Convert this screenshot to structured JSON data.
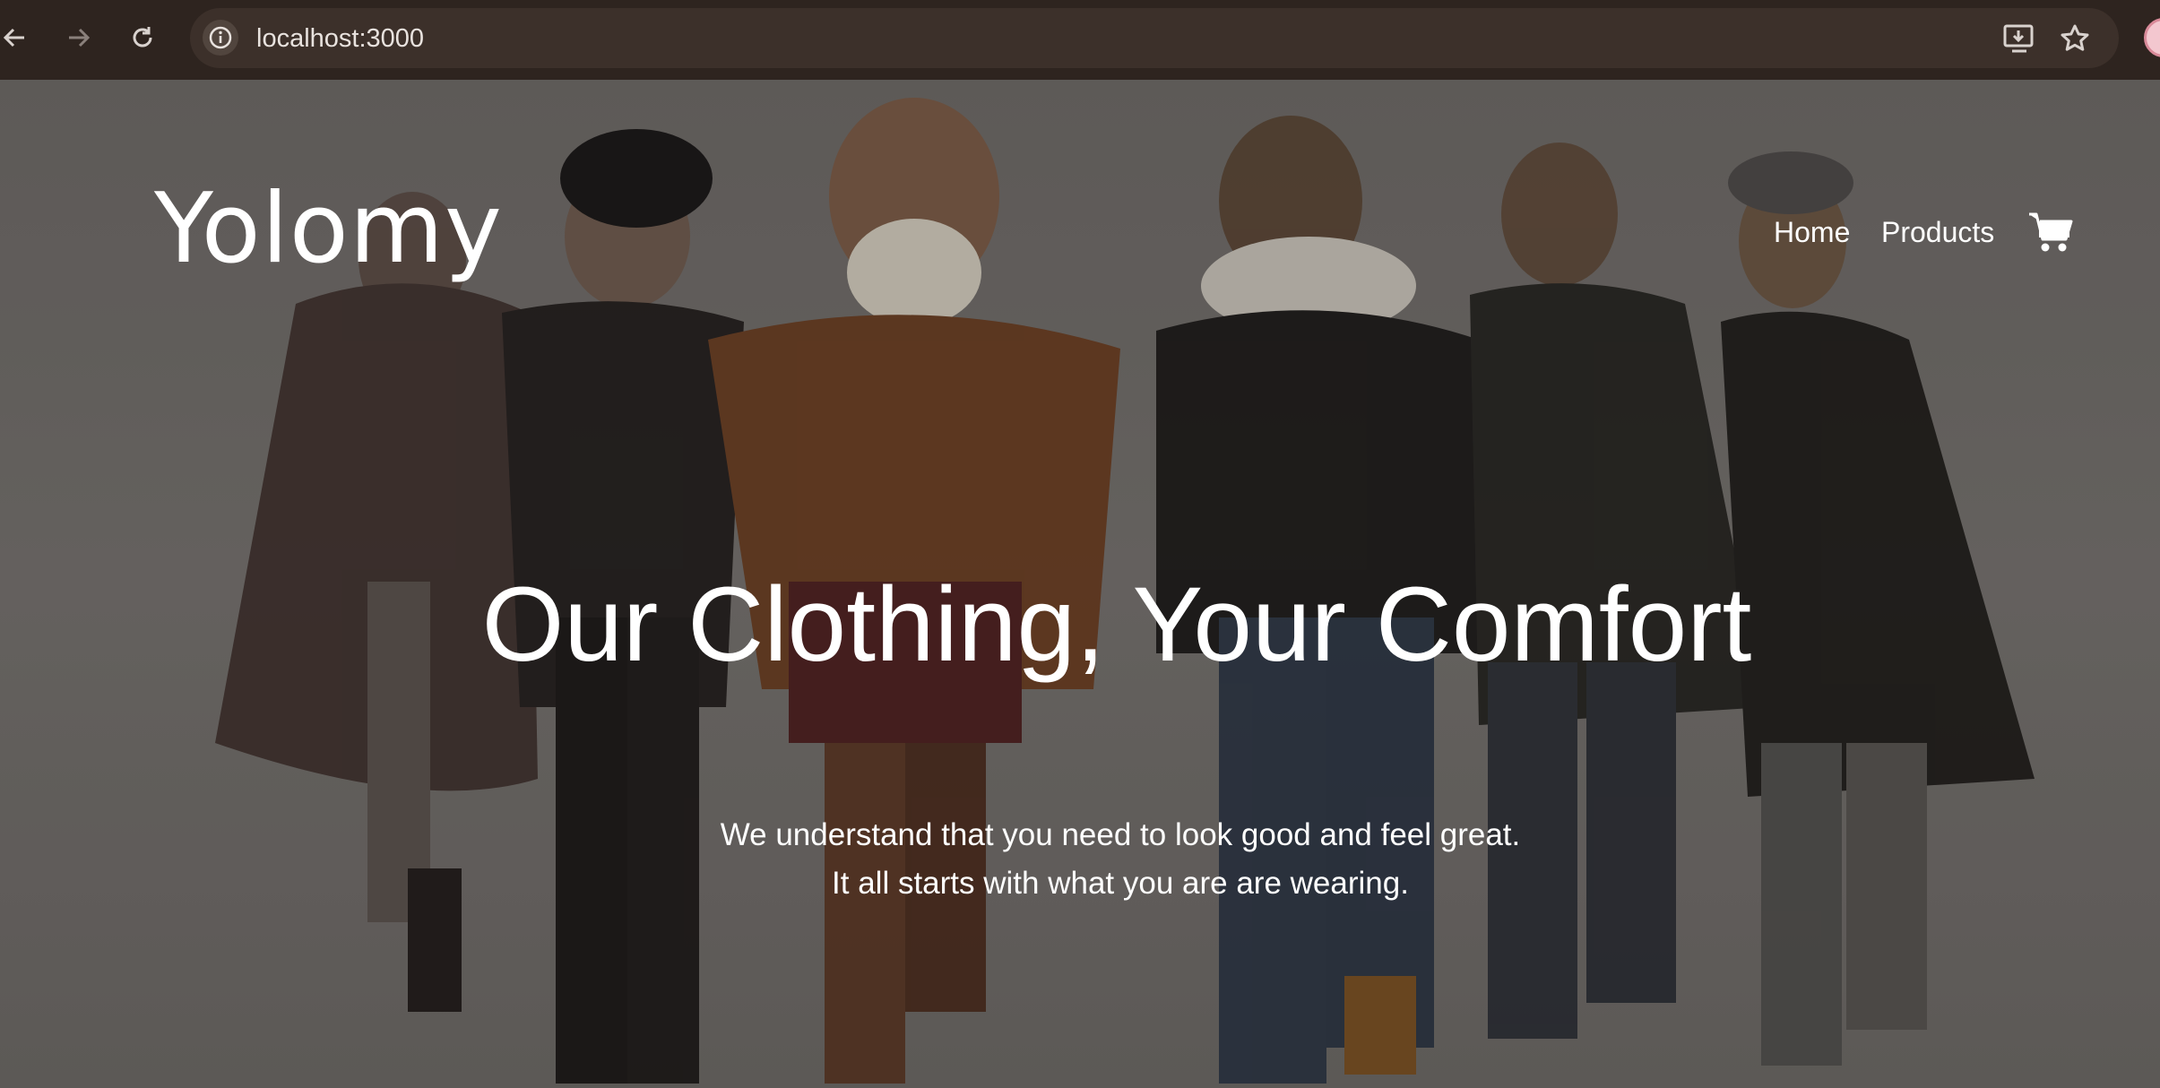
{
  "browser": {
    "url": "localhost:3000",
    "icons": [
      "back-arrow-icon",
      "forward-arrow-icon",
      "reload-icon",
      "site-info-icon",
      "install-app-icon",
      "bookmark-star-icon",
      "profile-avatar-icon"
    ]
  },
  "site": {
    "logo": "Yolomy",
    "nav": {
      "home": "Home",
      "products": "Products",
      "cart_icon": "shopping-cart-icon"
    },
    "hero": {
      "headline": "Our Clothing, Your Comfort",
      "subline_1": "We understand that you need to look good and feel great.",
      "subline_2": "It all starts with what you are are wearing."
    }
  },
  "colors": {
    "browser_bar": "#2e241f",
    "url_pill": "#3c302a",
    "hero_overlay": "#6f6b69",
    "text": "#ffffff"
  }
}
